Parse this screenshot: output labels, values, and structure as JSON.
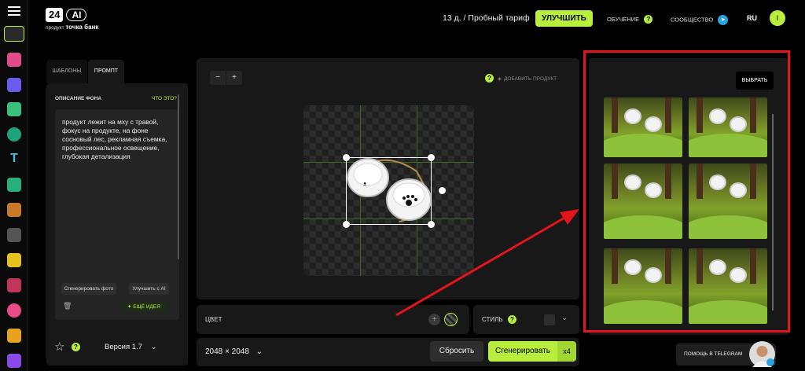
{
  "header": {
    "logo_num": "24",
    "logo_ai": "AI",
    "logo_sub_small": "продукт",
    "logo_sub_bold": "точка банк",
    "trial": "13 д.  /  Пробный тариф",
    "upgrade": "УЛУЧШИТЬ",
    "learning": "ОБУЧЕНИЕ",
    "community": "СООБЩЕСТВО",
    "lang": "RU",
    "avatar": "I"
  },
  "left_panel": {
    "tabs": [
      "ШАБЛОНЫ",
      "ПРОМПТ"
    ],
    "section_label": "ОПИСАНИЕ ФОНА",
    "what_is": "ЧТО ЭТО?",
    "prompt_text": "продукт лежит на мху с травой, фокус на продукте, на фоне сосновый лес, рекламная съемка, профессиональное освещение, глубокая детализация",
    "generate_photo": "Сгенерировать фото",
    "improve_ai": "Улучшить с AI",
    "more_ideas": "ЕЩЁ ИДЕЯ",
    "version": "Версия 1.7"
  },
  "canvas": {
    "zoom_minus": "−",
    "zoom_plus": "+",
    "add_product": "ДОБАВИТЬ ПРОДУКТ"
  },
  "controls": {
    "color_label": "ЦВЕТ",
    "style_label": "СТИЛЬ",
    "size": "2048 × 2048",
    "reset": "Сбросить",
    "generate": "Сгенерировать",
    "multiplier": "x4"
  },
  "results": {
    "choose": "ВЫБРАТЬ",
    "help_telegram": "ПОМОЩЬ В TELEGRAM"
  },
  "colors": {
    "accent": "#b8ef3c",
    "highlight_frame": "#e3141b",
    "telegram": "#2aa3df"
  }
}
